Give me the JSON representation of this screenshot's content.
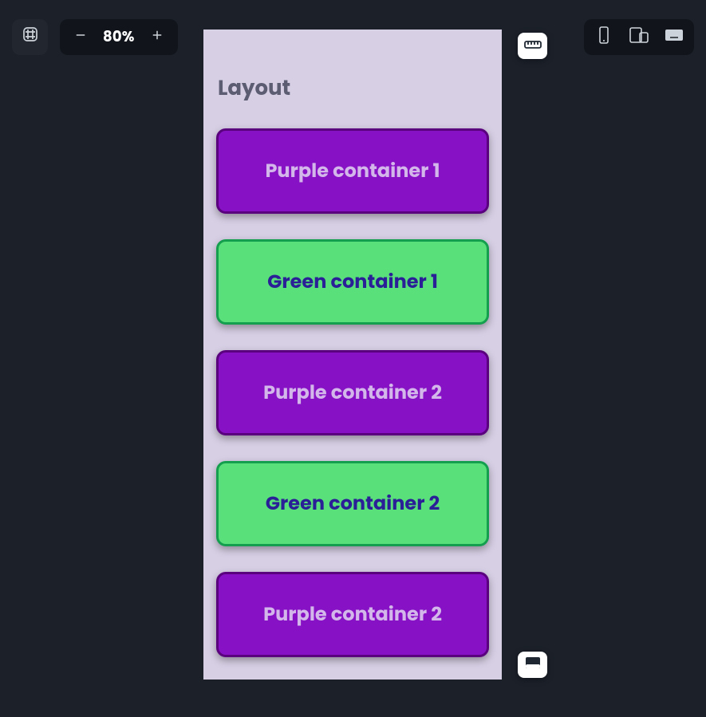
{
  "zoom": {
    "value": "80%"
  },
  "preview": {
    "title": "Layout",
    "cards": [
      {
        "type": "purple",
        "label": "Purple container 1"
      },
      {
        "type": "green",
        "label": "Green container 1"
      },
      {
        "type": "purple",
        "label": "Purple container 2"
      },
      {
        "type": "green",
        "label": "Green container 2"
      },
      {
        "type": "purple",
        "label": "Purple container 2"
      }
    ]
  }
}
